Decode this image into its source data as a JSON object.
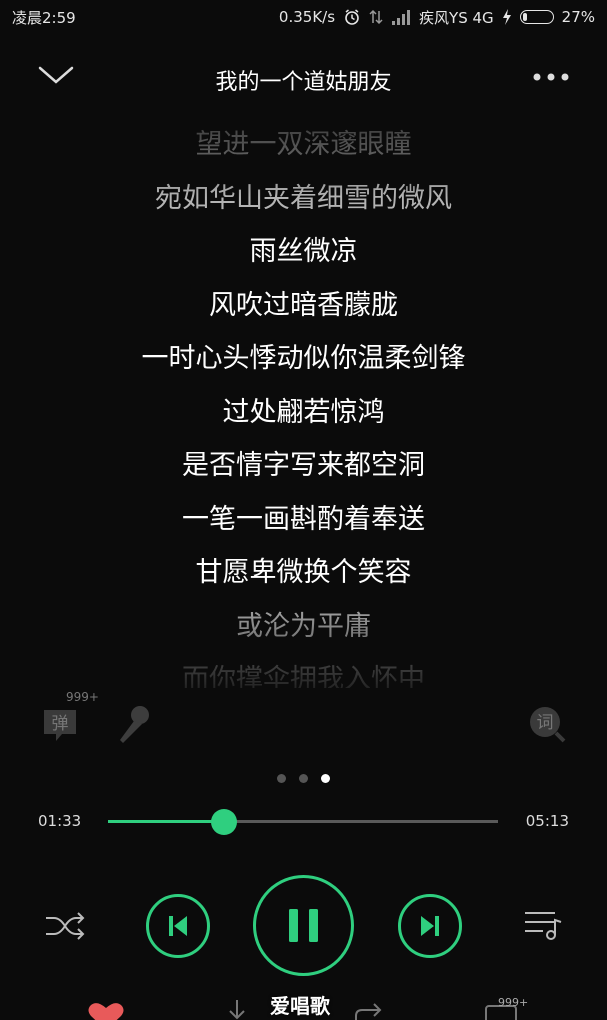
{
  "status": {
    "time": "凌晨2:59",
    "net_speed": "0.35K/s",
    "carrier": "疾风YS 4G",
    "battery": "27%",
    "battery_level": 0.27
  },
  "header": {
    "title": "我的一个道姑朋友"
  },
  "lyrics": [
    "望进一双深邃眼瞳",
    "宛如华山夹着细雪的微风",
    "雨丝微凉",
    "风吹过暗香朦胧",
    "一时心头悸动似你温柔剑锋",
    "过处翩若惊鸿",
    "是否情字写来都空洞",
    "一笔一画斟酌着奉送",
    "甘愿卑微换个笑容",
    "或沦为平庸",
    "而你撑伞拥我入怀中"
  ],
  "actions": {
    "danmu_label": "弹",
    "danmu_count": "999+",
    "lyrics_label": "词"
  },
  "pager": {
    "count": 3,
    "active": 2
  },
  "progress": {
    "current": "01:33",
    "total": "05:13",
    "fraction": 0.297
  },
  "bottom": {
    "watermark": "爱唱歌",
    "comment_count": "999+"
  },
  "colors": {
    "accent": "#2fcf7f"
  }
}
